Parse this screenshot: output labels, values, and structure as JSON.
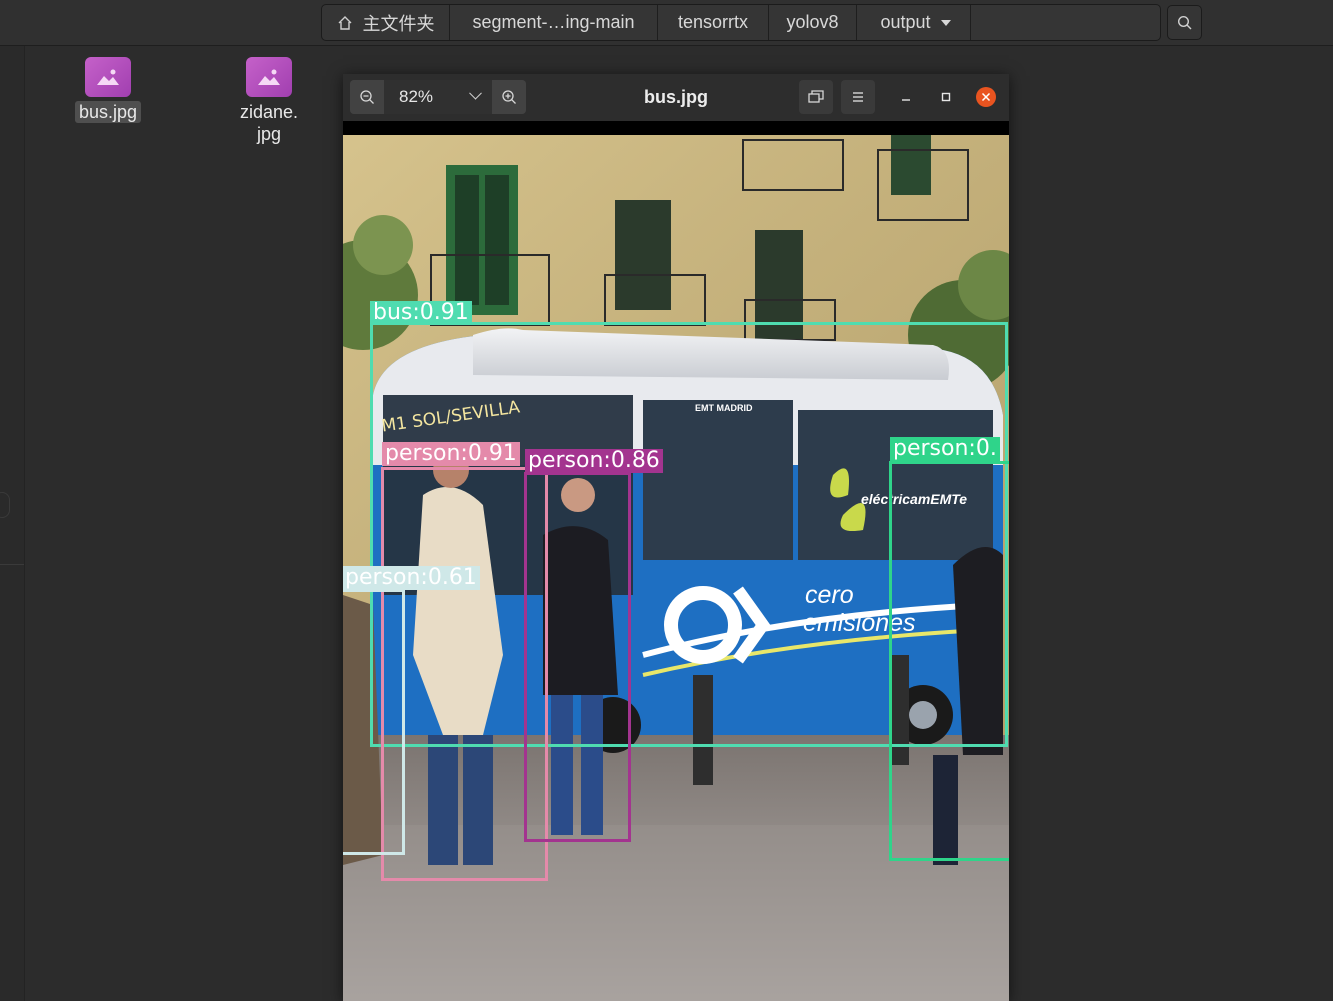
{
  "pathbar": {
    "home_label": "主文件夹",
    "crumbs": [
      "segment-…ing-main",
      "tensorrtx",
      "yolov8",
      "output"
    ]
  },
  "files": [
    {
      "name": "bus.jpg",
      "selected": true
    },
    {
      "name_line1": "zidane.",
      "name_line2": "jpg",
      "selected": false
    }
  ],
  "viewer": {
    "title": "bus.jpg",
    "zoom": "82%"
  },
  "detections": [
    {
      "label": "bus:0.91",
      "color": "#4fdcb0"
    },
    {
      "label": "person:0.91",
      "color": "#e48aaa"
    },
    {
      "label": "person:0.86",
      "color": "#a3348f"
    },
    {
      "label": "person:0.",
      "color": "#2fd48a"
    },
    {
      "label": "person:0.61",
      "color": "#cfe8e8"
    }
  ],
  "photo_text": {
    "bus_destination": "M1 SOL/SEVILLA",
    "bus_brand": "eléctricamEMTe",
    "bus_slogan_1": "cero",
    "bus_slogan_2": "emisiones",
    "bus_route_logo": "EMT MADRID"
  },
  "colors": {
    "accent_close": "#e95420",
    "file_icon": "#b64fc0",
    "bus_blue": "#1e6fc2"
  }
}
